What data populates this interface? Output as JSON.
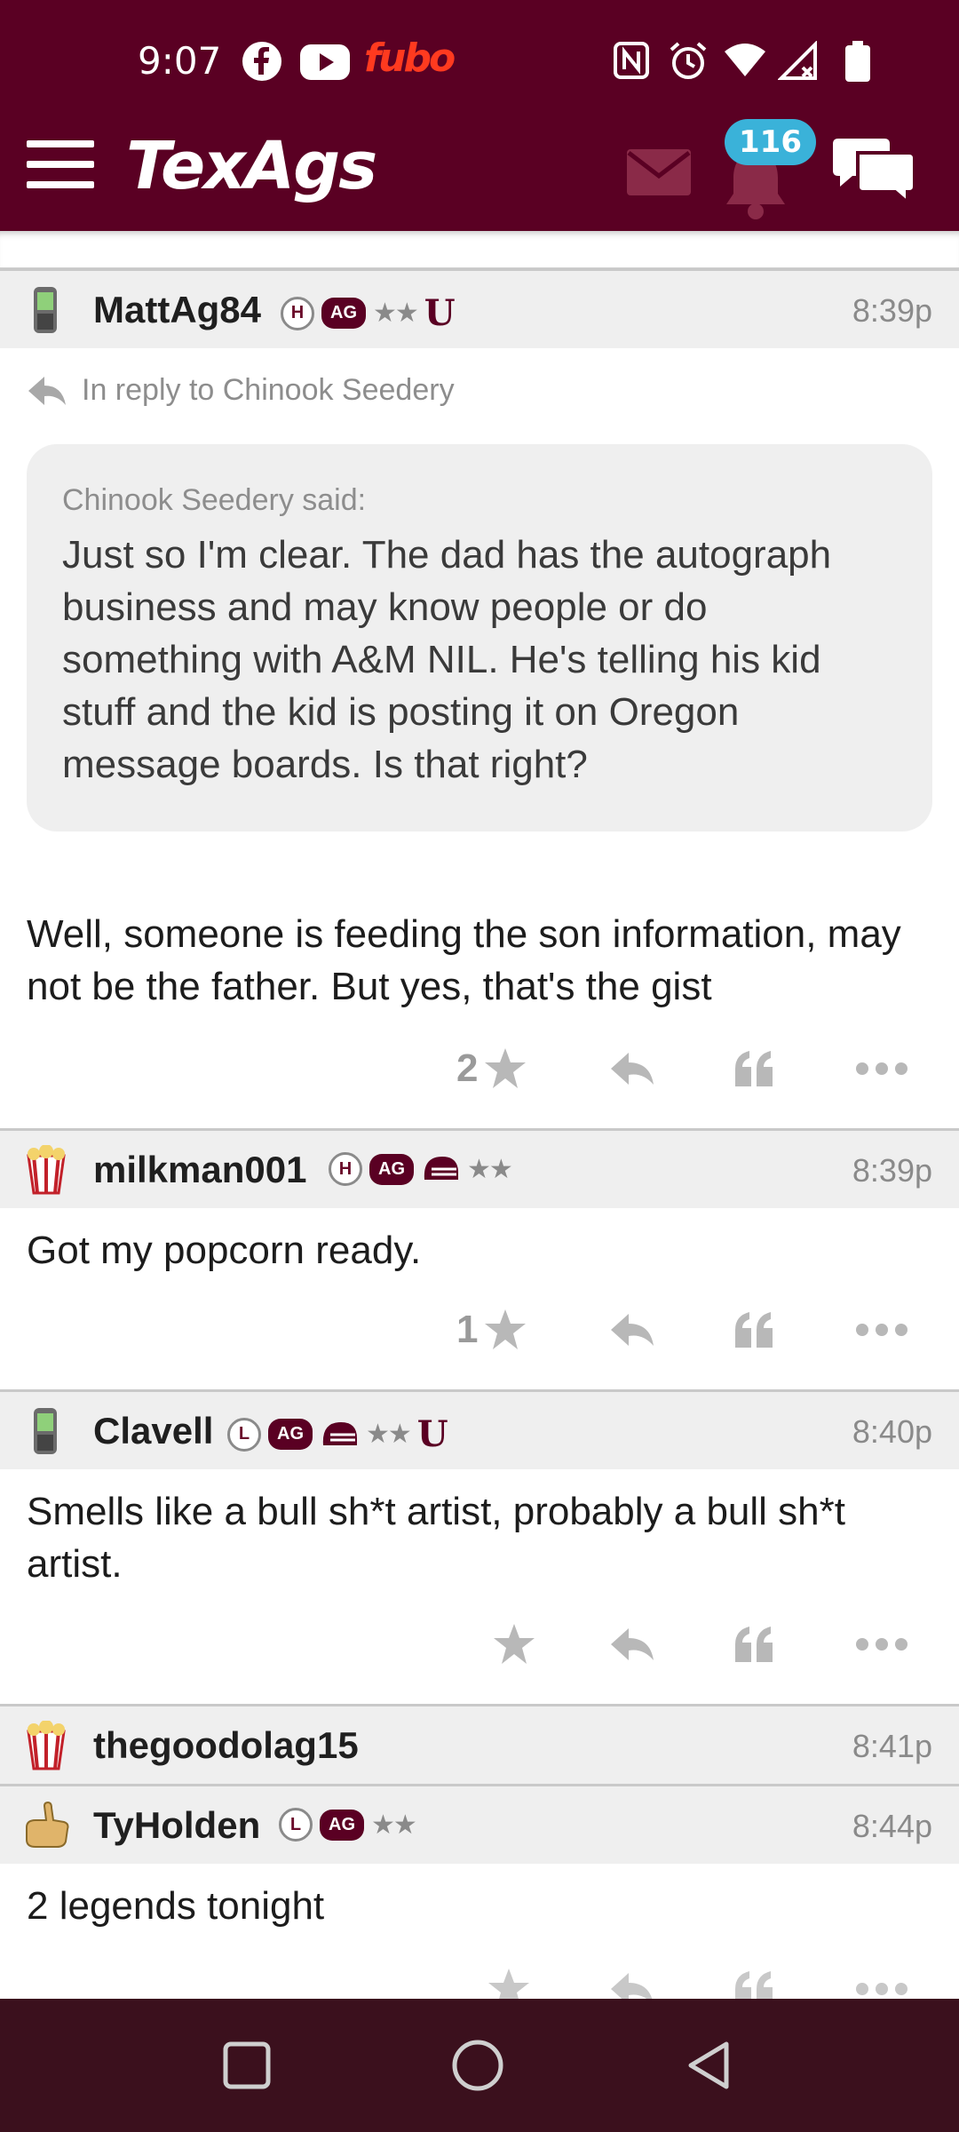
{
  "status_bar": {
    "time": "9:07",
    "fubo_label": "fubo"
  },
  "header": {
    "logo": "TexAgs",
    "notification_count": "116"
  },
  "posts": [
    {
      "username": "MattAg84",
      "time": "8:39p",
      "badges": [
        "H",
        "AG"
      ],
      "reply_to": "In reply to Chinook Seedery",
      "quote_author": "Chinook Seedery said:",
      "quote_text": "Just so I'm clear. The dad has the autograph business and may know people or do something with A&M NIL. He's telling his kid stuff and the kid is posting it on Oregon message boards. Is that right?",
      "body": "Well, someone is feeding the son information, may not be the father. But yes, that's the gist",
      "stars": "2"
    },
    {
      "username": "milkman001",
      "time": "8:39p",
      "badges": [
        "H",
        "AG"
      ],
      "body": "Got my popcorn ready.",
      "stars": "1"
    },
    {
      "username": "Clavell",
      "time": "8:40p",
      "badges": [
        "L",
        "AG"
      ],
      "body": "Smells like a bull sh*t artist, probably a bull sh*t artist.",
      "stars": ""
    },
    {
      "username": "thegoodolag15",
      "time": "8:41p"
    },
    {
      "username": "TyHolden",
      "time": "8:44p",
      "badges": [
        "L",
        "AG"
      ],
      "body": "2 legends tonight"
    }
  ],
  "colors": {
    "maroon": "#5a0023",
    "nav": "#3b101d",
    "badge_blue": "#3ab2d9"
  }
}
